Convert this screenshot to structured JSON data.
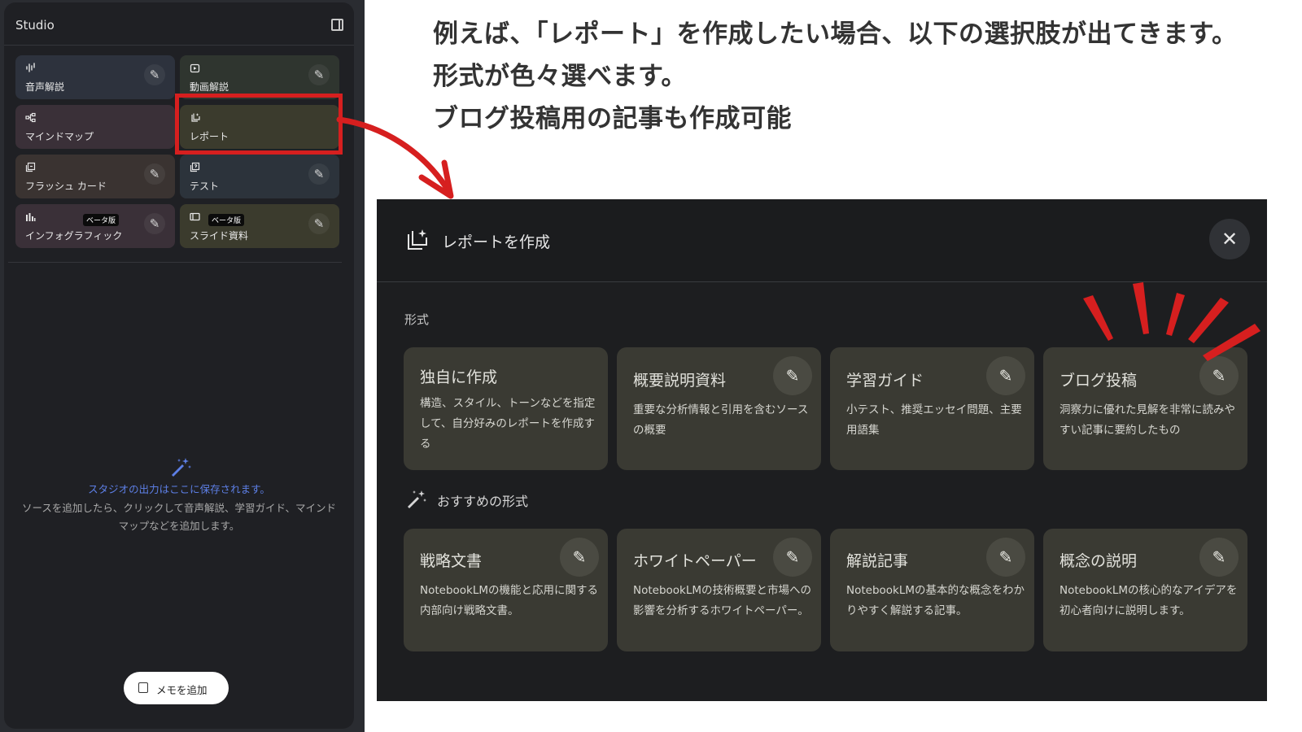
{
  "studio": {
    "title": "Studio",
    "panel_toggle_icon": "sidebar-toggle-icon",
    "tiles": [
      {
        "label": "音声解説",
        "icon": "audio-wave-icon",
        "edit_icon": "pencil-icon",
        "color": "#2d323d"
      },
      {
        "label": "動画解説",
        "icon": "video-icon",
        "edit_icon": "pencil-icon",
        "color": "#2f352f"
      },
      {
        "label": "マインドマップ",
        "icon": "mind-map-icon",
        "color": "#3a3038"
      },
      {
        "label": "レポート",
        "icon": "report-icon",
        "color": "#3b3b2d",
        "highlighted": true
      },
      {
        "label": "フラッシュ カード",
        "icon": "flashcard-icon",
        "edit_icon": "pencil-icon",
        "color": "#3a3331"
      },
      {
        "label": "テスト",
        "icon": "quiz-icon",
        "edit_icon": "pencil-icon",
        "color": "#2c333b"
      },
      {
        "label": "インフォグラフィック",
        "icon": "infographic-icon",
        "badge": "ベータ版",
        "edit_icon": "pencil-icon",
        "color": "#3a3038"
      },
      {
        "label": "スライド資料",
        "icon": "slides-icon",
        "badge": "ベータ版",
        "edit_icon": "pencil-icon",
        "color": "#3b3b2d"
      }
    ],
    "empty_state": {
      "icon": "magic-wand-icon",
      "title": "スタジオの出力はここに保存されます。",
      "description": "ソースを追加したら、クリックして音声解説、学習ガイド、マインドマップなどを追加します。"
    },
    "add_note": {
      "label": "メモを追加",
      "icon": "note-icon"
    }
  },
  "instructions": [
    "例えば、「レポート」を作成したい場合、以下の選択肢が出てきます。",
    "形式が色々選べます。",
    "ブログ投稿用の記事も作成可能"
  ],
  "dialog": {
    "title": "レポートを作成",
    "icon": "report-sparkle-icon",
    "close_icon": "close-icon",
    "format_label": "形式",
    "formats": [
      {
        "title": "独自に作成",
        "description": "構造、スタイル、トーンなどを指定して、自分好みのレポートを作成する"
      },
      {
        "title": "概要説明資料",
        "description": "重要な分析情報と引用を含むソースの概要",
        "edit_icon": "pencil-icon"
      },
      {
        "title": "学習ガイド",
        "description": "小テスト、推奨エッセイ問題、主要用語集",
        "edit_icon": "pencil-icon"
      },
      {
        "title": "ブログ投稿",
        "description": "洞察力に優れた見解を非常に読みやすい記事に要約したもの",
        "edit_icon": "pencil-icon"
      }
    ],
    "recommended_label": "おすすめの形式",
    "recommended_icon": "magic-wand-icon",
    "recommended": [
      {
        "title": "戦略文書",
        "description": "NotebookLMの機能と応用に関する内部向け戦略文書。",
        "edit_icon": "pencil-icon"
      },
      {
        "title": "ホワイトペーパー",
        "description": "NotebookLMの技術概要と市場への影響を分析するホワイトペーパー。",
        "edit_icon": "pencil-icon"
      },
      {
        "title": "解説記事",
        "description": "NotebookLMの基本的な概念をわかりやすく解説する記事。",
        "edit_icon": "pencil-icon"
      },
      {
        "title": "概念の説明",
        "description": "NotebookLMの核心的なアイデアを初心者向けに説明します。",
        "edit_icon": "pencil-icon"
      }
    ]
  },
  "colors": {
    "annotation_red": "#d61f1f",
    "accent_blue": "#5d7fe6",
    "card_bg": "#3a3a33",
    "dialog_bg": "#1d1e20"
  }
}
